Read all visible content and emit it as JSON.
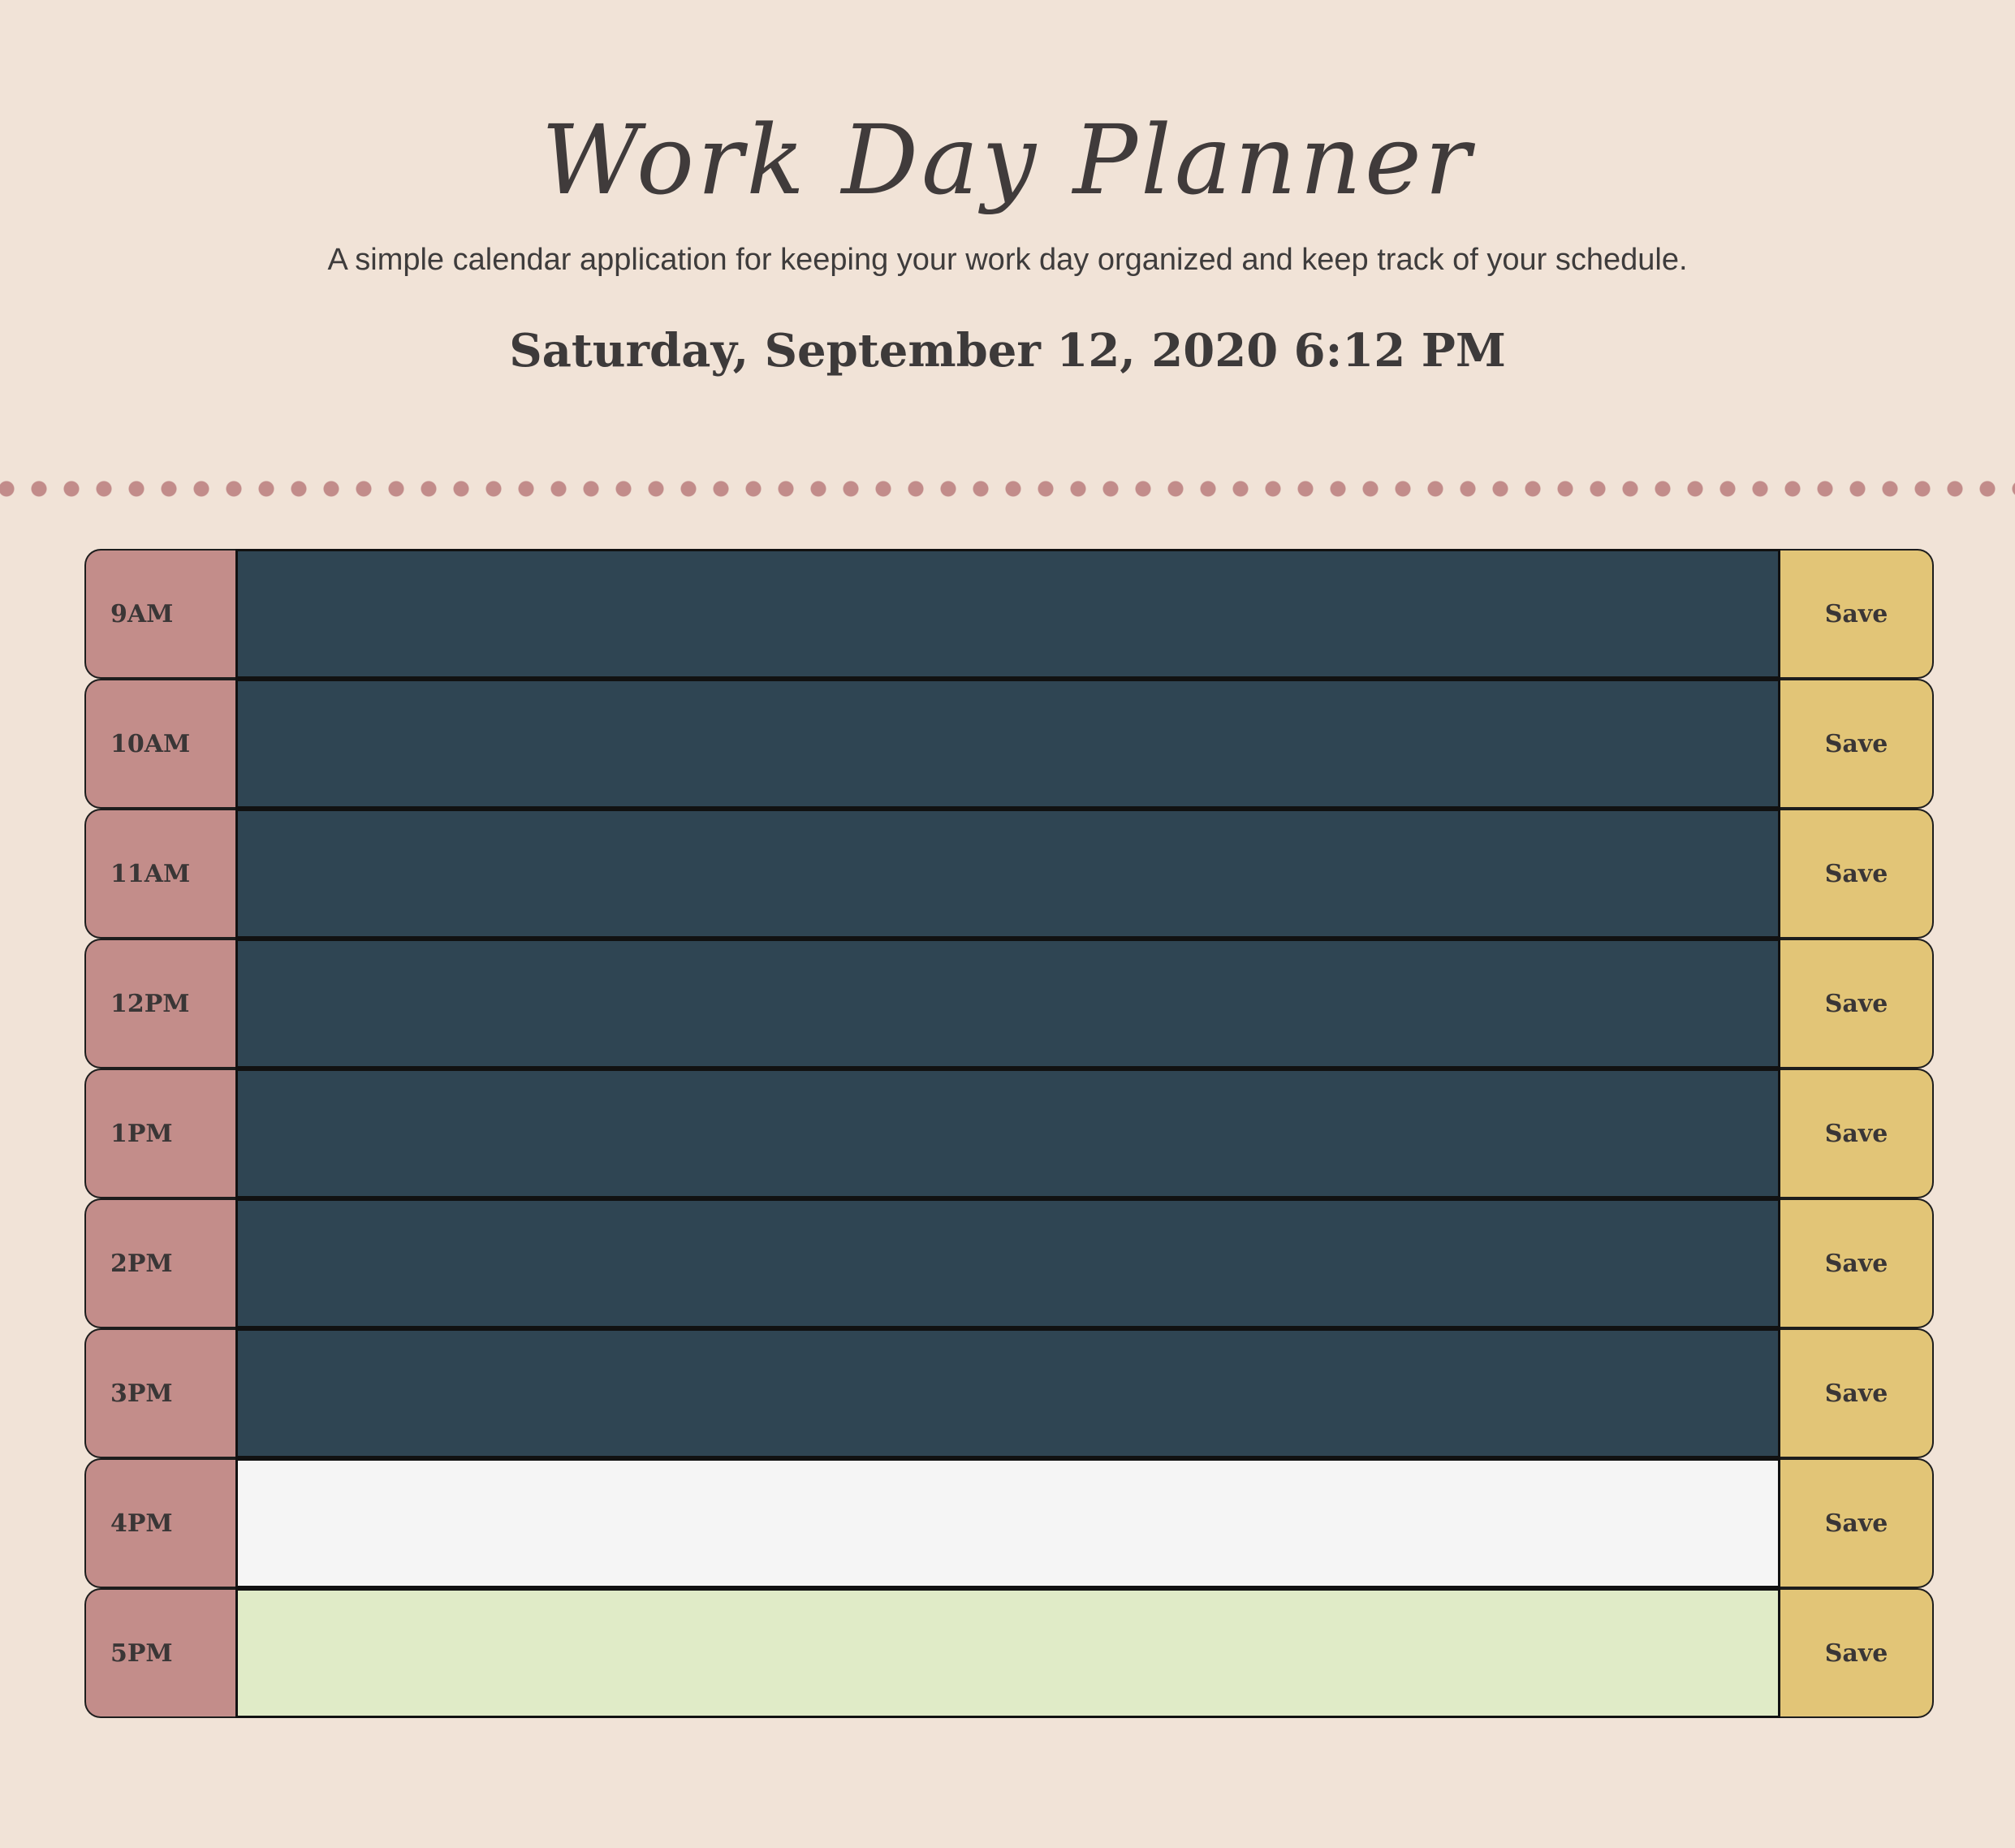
{
  "header": {
    "title": "Work Day Planner",
    "subtitle": "A simple calendar application for keeping your work day organized and keep track of your schedule.",
    "datetime": "Saturday, September 12, 2020 6:12 PM"
  },
  "colors": {
    "background": "#f1e3d7",
    "hour_block": "#c38d8a",
    "past": "#2f4553",
    "present": "#f5f5f5",
    "future": "#e0ebc7",
    "save_button": "#e2c577",
    "divider_dots": "#c28c8a"
  },
  "planner": {
    "rows": [
      {
        "hour": "9AM",
        "status": "past",
        "text": "",
        "save_label": "Save"
      },
      {
        "hour": "10AM",
        "status": "past",
        "text": "",
        "save_label": "Save"
      },
      {
        "hour": "11AM",
        "status": "past",
        "text": "",
        "save_label": "Save"
      },
      {
        "hour": "12PM",
        "status": "past",
        "text": "",
        "save_label": "Save"
      },
      {
        "hour": "1PM",
        "status": "past",
        "text": "",
        "save_label": "Save"
      },
      {
        "hour": "2PM",
        "status": "past",
        "text": "",
        "save_label": "Save"
      },
      {
        "hour": "3PM",
        "status": "past",
        "text": "",
        "save_label": "Save"
      },
      {
        "hour": "4PM",
        "status": "present",
        "text": "",
        "save_label": "Save"
      },
      {
        "hour": "5PM",
        "status": "future",
        "text": "",
        "save_label": "Save"
      }
    ]
  }
}
